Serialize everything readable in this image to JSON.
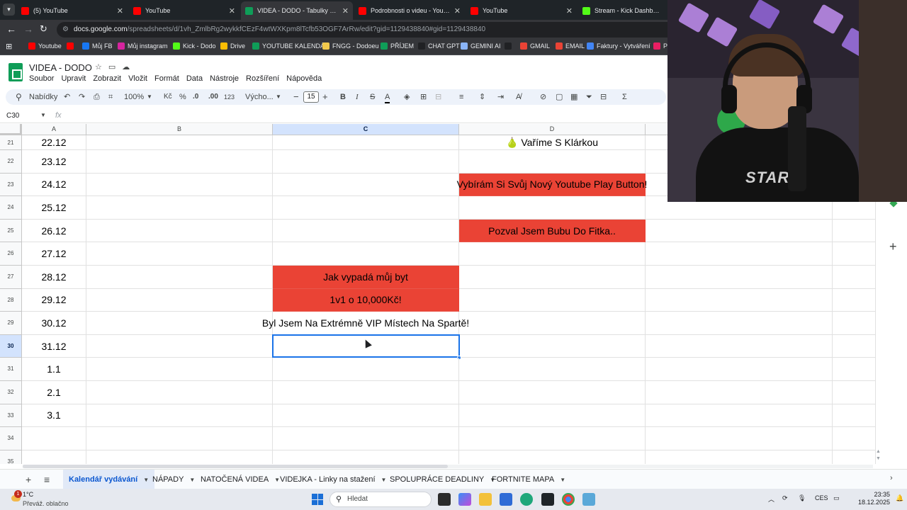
{
  "browser": {
    "tabs": [
      {
        "title": "(5) YouTube",
        "icon": "youtube-icon",
        "color": "#ff0000",
        "active": false
      },
      {
        "title": "YouTube",
        "icon": "youtube-icon",
        "color": "#ff0000",
        "active": false
      },
      {
        "title": "VIDEA - DODO - Tabulky Goog",
        "icon": "sheets-icon",
        "color": "#0f9d58",
        "active": true
      },
      {
        "title": "Podrobnosti o videu - YouTube",
        "icon": "youtube-icon",
        "color": "#ff0000",
        "active": false
      },
      {
        "title": "YouTube",
        "icon": "youtube-icon",
        "color": "#ff0000",
        "active": false
      },
      {
        "title": "Stream - Kick Dashboard",
        "icon": "kick-icon",
        "color": "#53fc18",
        "active": false
      }
    ],
    "url_host": "docs.google.com",
    "url_path": "/spreadsheets/d/1vh_ZmlbRg2wykkfCEzF4wtWXKpm8lTcfb53OGF7ArRw/edit?gid=1129438840#gid=1129438840",
    "bookmarks": [
      {
        "label": "Youtube",
        "color": "#ff0000"
      },
      {
        "label": "",
        "color": "#ff0000"
      },
      {
        "label": "Můj FB",
        "color": "#1877f2"
      },
      {
        "label": "Můj instagram",
        "color": "#d6249f"
      },
      {
        "label": "Kick - Dodo",
        "color": "#53fc18"
      },
      {
        "label": "Drive",
        "color": "#fbbc04"
      },
      {
        "label": "YOUTUBE KALENDÁŘ",
        "color": "#0f9d58"
      },
      {
        "label": "FNGG - Dodoeu",
        "color": "#f2c94c"
      },
      {
        "label": "PŘÍJEM",
        "color": "#0f9d58"
      },
      {
        "label": "CHAT GPT",
        "color": "#202124"
      },
      {
        "label": "GEMINI AI",
        "color": "#8ab4f8"
      },
      {
        "label": "",
        "color": "#202124"
      },
      {
        "label": "GMAIL",
        "color": "#ea4335"
      },
      {
        "label": "EMAIL",
        "color": "#ea4335"
      },
      {
        "label": "Faktury - Vytváření",
        "color": "#4285f4"
      },
      {
        "label": "P",
        "color": "#e91e63"
      }
    ]
  },
  "sheets": {
    "doc_title": "VIDEA - DODO",
    "menu": [
      "Soubor",
      "Upravit",
      "Zobrazit",
      "Vložit",
      "Formát",
      "Data",
      "Nástroje",
      "Rozšíření",
      "Nápověda"
    ],
    "toolbar": {
      "search_label": "Nabídky",
      "zoom": "100%",
      "currency": "Kč",
      "percent": "%",
      "dec_decrease": ".0",
      "dec_increase": ".00",
      "number_format": "123",
      "font": "Výcho...",
      "font_size": "15"
    },
    "name_box": "C30",
    "formula_symbol": "fx",
    "columns": [
      {
        "label": "A",
        "selected": false
      },
      {
        "label": "B",
        "selected": false
      },
      {
        "label": "C",
        "selected": true
      },
      {
        "label": "D",
        "selected": false
      }
    ],
    "rows": [
      {
        "num": "21",
        "a": "22.12",
        "b": "",
        "c": "",
        "d": "🍐 Vaříme S Klárkou",
        "c_red": false,
        "d_red": false,
        "selected": false
      },
      {
        "num": "22",
        "a": "23.12",
        "b": "",
        "c": "",
        "d": "",
        "c_red": false,
        "d_red": false,
        "selected": false
      },
      {
        "num": "23",
        "a": "24.12",
        "b": "",
        "c": "",
        "d": "Vybírám Si Svůj Nový Youtube Play Button!",
        "c_red": false,
        "d_red": true,
        "selected": false
      },
      {
        "num": "24",
        "a": "25.12",
        "b": "",
        "c": "",
        "d": "",
        "c_red": false,
        "d_red": false,
        "selected": false
      },
      {
        "num": "25",
        "a": "26.12",
        "b": "",
        "c": "",
        "d": "Pozval Jsem Bubu Do Fitka..",
        "c_red": false,
        "d_red": true,
        "selected": false
      },
      {
        "num": "26",
        "a": "27.12",
        "b": "",
        "c": "",
        "d": "",
        "c_red": false,
        "d_red": false,
        "selected": false
      },
      {
        "num": "27",
        "a": "28.12",
        "b": "",
        "c": "Jak vypadá můj byt",
        "d": "",
        "c_red": true,
        "d_red": false,
        "selected": false
      },
      {
        "num": "28",
        "a": "29.12",
        "b": "",
        "c": "1v1 o 10,000Kč!",
        "d": "",
        "c_red": true,
        "d_red": false,
        "selected": false
      },
      {
        "num": "29",
        "a": "30.12",
        "b": "",
        "c": "Byl Jsem Na Extrémně VIP Místech Na Spartě!",
        "d": "",
        "c_red": false,
        "d_red": false,
        "selected": false
      },
      {
        "num": "30",
        "a": "31.12",
        "b": "",
        "c": "",
        "d": "",
        "c_red": false,
        "d_red": false,
        "selected": true
      },
      {
        "num": "31",
        "a": "1.1",
        "b": "",
        "c": "",
        "d": "",
        "c_red": false,
        "d_red": false,
        "selected": false
      },
      {
        "num": "32",
        "a": "2.1",
        "b": "",
        "c": "",
        "d": "",
        "c_red": false,
        "d_red": false,
        "selected": false
      },
      {
        "num": "33",
        "a": "3.1",
        "b": "",
        "c": "",
        "d": "",
        "c_red": false,
        "d_red": false,
        "selected": false
      },
      {
        "num": "34",
        "a": "",
        "b": "",
        "c": "",
        "d": "",
        "c_red": false,
        "d_red": false,
        "selected": false
      },
      {
        "num": "35",
        "a": "",
        "b": "",
        "c": "",
        "d": "",
        "c_red": false,
        "d_red": false,
        "selected": false
      }
    ],
    "sheet_tabs": [
      {
        "label": "Kalendář vydávání",
        "active": true
      },
      {
        "label": "NÁPADY",
        "active": false
      },
      {
        "label": "NATOČENÁ VIDEA",
        "active": false
      },
      {
        "label": "VIDEJKA - Linky na stažení",
        "active": false
      },
      {
        "label": "SPOLUPRÁCE DEADLINY",
        "active": false
      },
      {
        "label": "FORTNITE MAPA",
        "active": false
      }
    ]
  },
  "taskbar": {
    "weather_temp": "1°C",
    "weather_cond": "Převáž. oblačno",
    "notification_count": "1",
    "search_placeholder": "Hledat",
    "language": "CES",
    "time": "23:35",
    "date": "18.12.2025"
  },
  "colors": {
    "red_fill": "#ea4335",
    "selection": "#1a73e8",
    "selected_header": "#d3e3fd"
  }
}
